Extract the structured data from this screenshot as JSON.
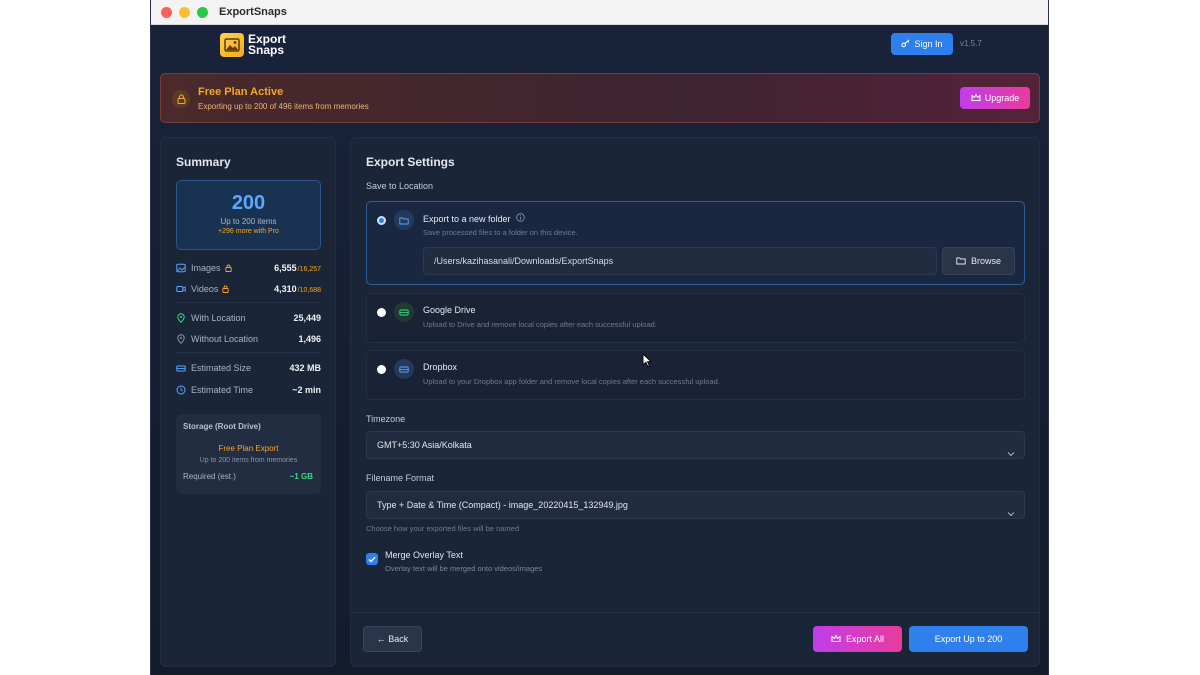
{
  "window": {
    "title": "ExportSnaps"
  },
  "header": {
    "logo_line1": "Export",
    "logo_line2": "Snaps",
    "sign_in": "Sign In",
    "version": "v1.5.7"
  },
  "banner": {
    "title": "Free Plan Active",
    "subtitle": "Exporting up to 200 of 496 items from memories",
    "upgrade": "Upgrade"
  },
  "summary": {
    "title": "Summary",
    "big_number": "200",
    "big_sub": "Up to 200 items",
    "big_more": "+296 more with Pro",
    "rows": [
      {
        "label": "Images",
        "value": "6,555",
        "max": "/16,257",
        "icon": "image-icon"
      },
      {
        "label": "Videos",
        "value": "4,310",
        "max": "/10,688",
        "icon": "video-icon"
      },
      {
        "label": "With Location",
        "value": "25,449",
        "icon": "location-pin-icon"
      },
      {
        "label": "Without Location",
        "value": "1,496",
        "icon": "location-off-icon"
      },
      {
        "label": "Estimated Size",
        "value": "432 MB",
        "icon": "drive-icon"
      },
      {
        "label": "Estimated Time",
        "value": "~2 min",
        "icon": "clock-icon"
      }
    ],
    "storage": {
      "title": "Storage (Root Drive)",
      "plan": "Free Plan Export",
      "plan_sub": "Up to 200 items from memories",
      "required_label": "Required (est.)",
      "required_value": "~1 GB"
    }
  },
  "settings": {
    "title": "Export Settings",
    "save_label": "Save to Location",
    "options": [
      {
        "name": "Export to a new folder",
        "desc": "Save processed files to a folder on this device.",
        "selected": true
      },
      {
        "name": "Google Drive",
        "desc": "Upload to Drive and remove local copies after each successful upload.",
        "selected": false
      },
      {
        "name": "Dropbox",
        "desc": "Upload to your Dropbox app folder and remove local copies after each successful upload.",
        "selected": false
      }
    ],
    "path": "/Users/kazihasanali/Downloads/ExportSnaps",
    "browse": "Browse",
    "timezone_label": "Timezone",
    "timezone_value": "GMT+5:30 Asia/Kolkata",
    "filename_label": "Filename Format",
    "filename_value": "Type + Date & Time (Compact) - image_20220415_132949.jpg",
    "filename_hint": "Choose how your exported files will be named",
    "merge_label": "Merge Overlay Text",
    "merge_desc": "Overlay text will be merged onto videos/images",
    "merge_checked": true
  },
  "footer": {
    "back": "← Back",
    "export_all": "Export All",
    "export_up": "Export Up to 200"
  },
  "colors": {
    "accent": "#2f80ed",
    "warning": "#f5a623",
    "upgrade_start": "#c13dea",
    "upgrade_end": "#e93b9c",
    "success": "#3ddc84"
  }
}
